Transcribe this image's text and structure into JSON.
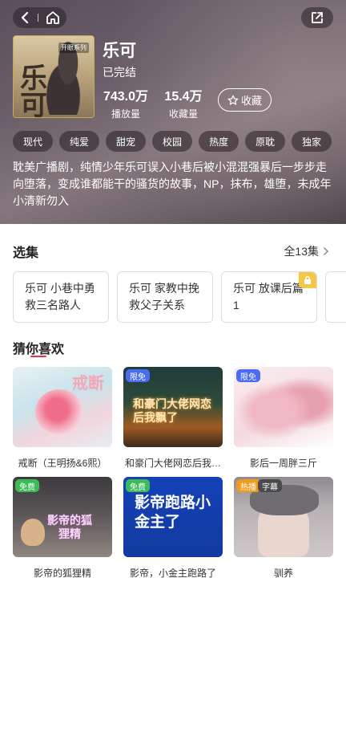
{
  "header": {
    "title": "乐可",
    "status": "已完结",
    "play_count": "743.0万",
    "play_label": "播放量",
    "fav_count": "15.4万",
    "fav_label": "收藏量",
    "collect_label": "收藏",
    "cover_char": "乐可",
    "cover_tag": "开眼系列"
  },
  "tags": [
    "现代",
    "纯爱",
    "甜宠",
    "校园",
    "热度",
    "原耽",
    "独家"
  ],
  "description": "耽美广播剧，纯情少年乐可误入小巷后被小混混强暴后一步步走向堕落，变成谁都能干的骚货的故事，NP，抹布，雄堕，未成年小清新勿入",
  "episodes_section": {
    "title": "选集",
    "count": "全13集",
    "items": [
      {
        "label": "乐可 小巷中勇救三名路人",
        "locked": false
      },
      {
        "label": "乐可 家教中挽救父子关系",
        "locked": false
      },
      {
        "label": "乐可 放课后篇1",
        "locked": true
      }
    ]
  },
  "recommend": {
    "title": "猜你喜欢",
    "items": [
      {
        "title": "戒断（王明扬&6熙）",
        "badges": [],
        "thumb_text": "戒断"
      },
      {
        "title": "和豪门大佬网恋后我…",
        "badges": [
          "限免"
        ],
        "thumb_text": "和豪门大佬网恋后我飘了"
      },
      {
        "title": "影后一周胖三斤",
        "badges": [
          "限免"
        ],
        "thumb_text": ""
      },
      {
        "title": "影帝的狐狸精",
        "badges": [
          "免费"
        ],
        "thumb_text": "影帝的狐狸精"
      },
      {
        "title": "影帝，小金主跑路了",
        "badges": [
          "免费"
        ],
        "thumb_text": "影帝跑路小金主了"
      },
      {
        "title": "驯养",
        "badges": [
          "热播",
          "字幕"
        ],
        "thumb_text": ""
      }
    ]
  },
  "colors": {
    "accent": "#e0334f",
    "badge_blue": "#4a6cf0",
    "badge_green": "#3dbb59",
    "badge_orange": "#f29b1d",
    "lock_yellow": "#f4c744"
  }
}
